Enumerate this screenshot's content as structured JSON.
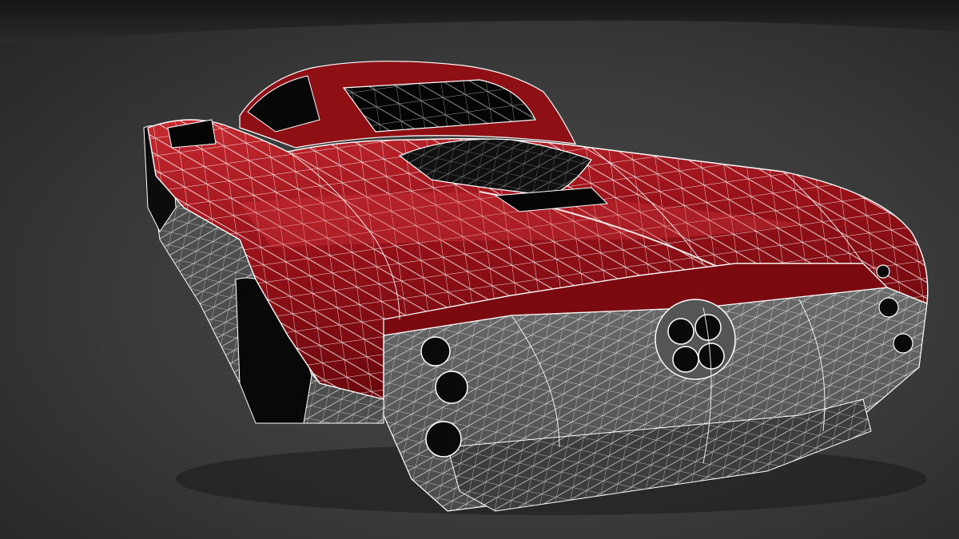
{
  "scene": {
    "subject": "car-wireframe-render",
    "colors": {
      "backdrop_top": "#1c1c1c",
      "backdrop_floor": "#454545",
      "body_paint": "#8e0f14",
      "body_paint_highlight": "#c4242b",
      "lower_body": "#5a5a5a",
      "glass": "#0b0b0b",
      "wire": "#ffffff"
    }
  }
}
